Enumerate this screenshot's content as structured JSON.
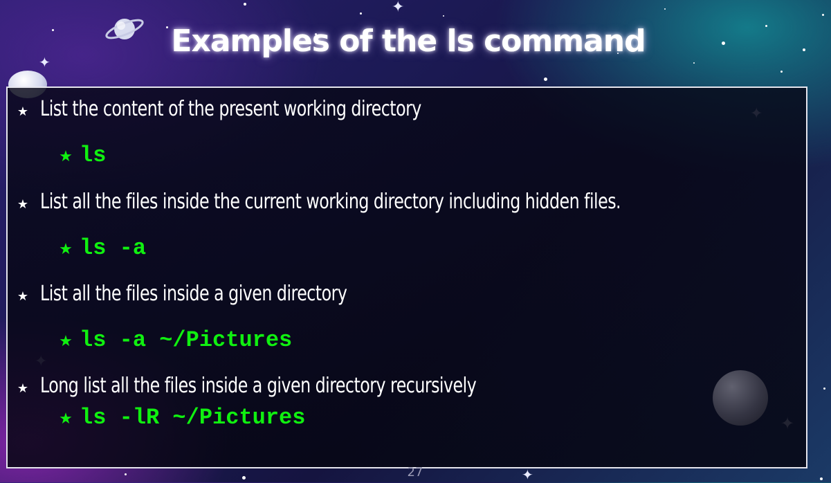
{
  "slide": {
    "title": "Examples of the ls command",
    "page_number": "27"
  },
  "bullets": [
    {
      "marker": "★",
      "text": "List the content of the present working directory",
      "command_marker": "★",
      "command": "ls"
    },
    {
      "marker": "★",
      "text": "List all the files inside the current working directory including hidden files.",
      "command_marker": "★",
      "command": "ls -a"
    },
    {
      "marker": "★",
      "text": "List all the files inside a given directory",
      "command_marker": "★",
      "command": "ls -a ~/Pictures"
    },
    {
      "marker": "★",
      "text": "Long list all the files inside a given directory recursively",
      "command_marker": "★",
      "command": "ls -lR ~/Pictures"
    }
  ],
  "colors": {
    "command_green": "#10f010",
    "text_white": "#ffffff",
    "panel_border": "#e6e6ee"
  }
}
